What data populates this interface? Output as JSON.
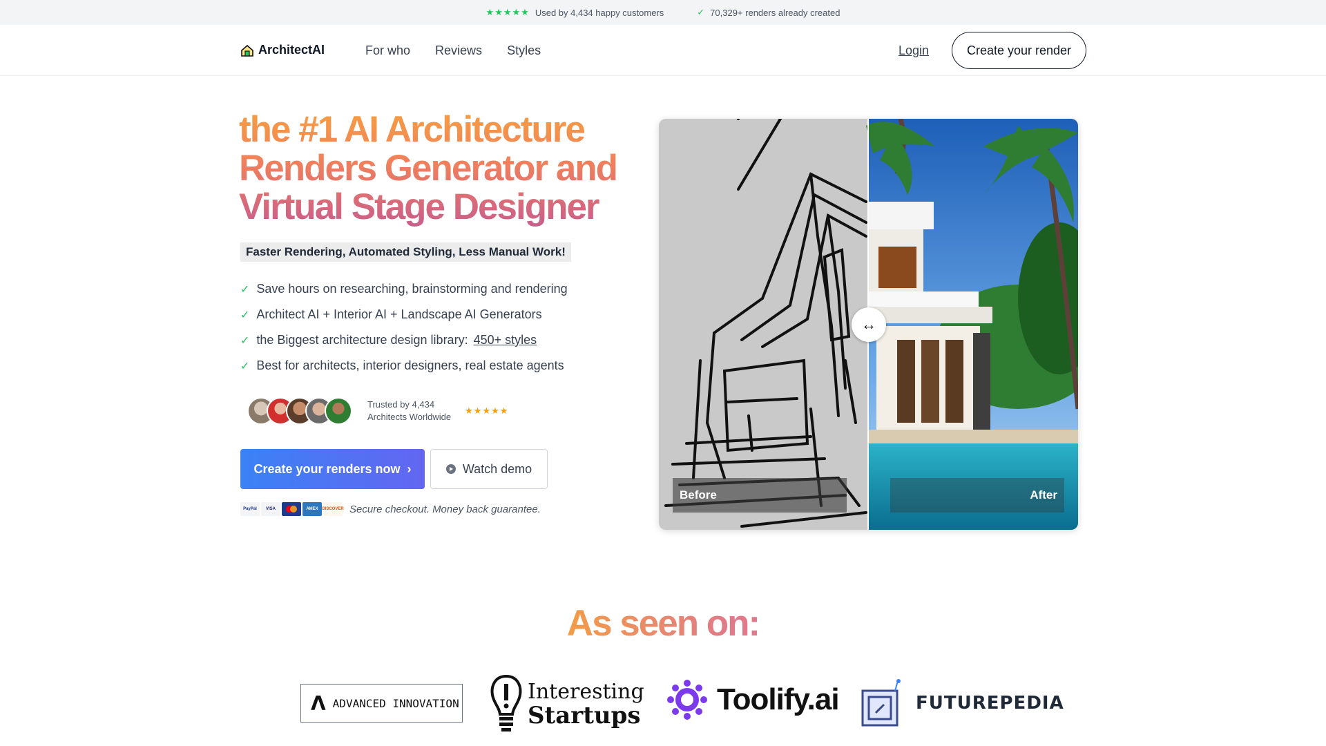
{
  "topbar": {
    "stars": "★★★★★",
    "customers_text": "Used by 4,434 happy customers",
    "check": "✓",
    "renders_text": "70,329+ renders already created"
  },
  "nav": {
    "logo_text": "ArchitectAI",
    "links": [
      "For who",
      "Reviews",
      "Styles"
    ],
    "login": "Login",
    "create_button": "Create your render"
  },
  "hero": {
    "title_lines": [
      "the #1 AI Architecture",
      "Renders Generator and",
      "Virtual Stage Designer"
    ],
    "subtitle": "Faster Rendering, Automated Styling, Less Manual Work!",
    "bullets": [
      "Save hours on researching, brainstorming and rendering",
      "Architect AI + Interior AI + Landscape AI Generators",
      "the Biggest architecture design library:",
      "Best for architects, interior designers, real estate agents"
    ],
    "styles_link": "450+ styles",
    "trust_line1": "Trusted by 4,434",
    "trust_line2": "Architects Worldwide",
    "trust_stars": "★★★★★",
    "cta_primary": "Create your renders now",
    "cta_primary_arrow": "›",
    "cta_secondary": "Watch demo",
    "payment_methods": [
      "PayPal",
      "VISA",
      "MC",
      "AMEX",
      "DISCOVER"
    ],
    "secure_text": "Secure checkout. Money back guarantee."
  },
  "compare": {
    "before_label": "Before",
    "after_label": "After",
    "handle_icon": "↔"
  },
  "seen_on": {
    "title": "As seen on:",
    "advanced_mark": "Λ",
    "advanced": "ADVANCED INNOVATION",
    "startups_line1": "Interesting",
    "startups_line2": "Startups",
    "toolify": "Toolify.ai",
    "futurepedia": "FUTUREPEDIA"
  },
  "colors": {
    "accent_blue": "#3b82f6",
    "accent_indigo": "#6366f1",
    "title_orange": "#f59e42",
    "title_pink": "#c95e8c",
    "check_green": "#22c55e",
    "star_gold": "#f59e0b"
  }
}
